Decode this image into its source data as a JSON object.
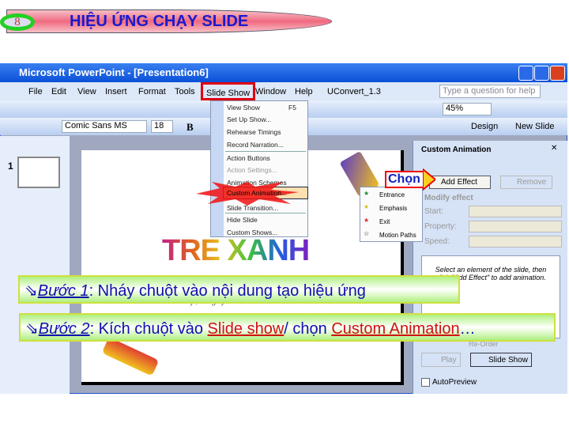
{
  "slide": {
    "number": "8",
    "title": "HIỆU ỨNG CHẠY SLIDE"
  },
  "window": {
    "title": "Microsoft PowerPoint - [Presentation6]"
  },
  "menubar": [
    "File",
    "Edit",
    "View",
    "Insert",
    "Format",
    "Tools",
    "Slide Show",
    "Window",
    "Help",
    "UConvert_1.3"
  ],
  "help_placeholder": "Type a question for help",
  "toolbar": {
    "zoom": "45%",
    "font": "Comic Sans MS",
    "size": "18",
    "bold": "B",
    "design": "Design",
    "new_slide": "New Slide"
  },
  "thumbnail_number": "1",
  "slideshow_menu": [
    {
      "label": "View Show",
      "shortcut": "F5"
    },
    {
      "label": "Set Up Show..."
    },
    {
      "label": "Rehearse Timings"
    },
    {
      "label": "Record Narration..."
    },
    {
      "label": "Action Buttons"
    },
    {
      "label": "Action Settings..."
    },
    {
      "label": "Animation Schemes"
    },
    {
      "label": "Custom Animation..."
    },
    {
      "label": "Slide Transition..."
    },
    {
      "label": "Hide Slide"
    },
    {
      "label": "Custom Shows..."
    }
  ],
  "add_effect_submenu": [
    "Entrance",
    "Emphasis",
    "Exit",
    "Motion Paths"
  ],
  "task_pane": {
    "title": "Custom Animation",
    "add_effect": "Add Effect",
    "remove": "Remove",
    "modify": "Modify effect",
    "fields": [
      "Start:",
      "Property:",
      "Speed:"
    ],
    "hint": "Select an element of the slide, then click \"Add Effect\" to add animation.",
    "reorder": "Re-Order",
    "play": "Play",
    "slide_show": "Slide Show",
    "autopreview": "AutoPreview"
  },
  "slide_content": {
    "logo": "TRE XANH",
    "subtitle": "Chuyện ngày xưa đã có bờ tre xanh"
  },
  "callout": "Chọn",
  "steps": [
    {
      "label": "Bước 1",
      "text": ":  Nháy chuột vào nội dung tạo hiệu ứng"
    },
    {
      "label": "Bước 2",
      "text": ": Kích chuột vào ",
      "link1": "Slide show",
      "mid": "/ chọn ",
      "link2": "Custom Animation",
      "end": "…"
    }
  ],
  "colors": {
    "accent_blue": "#1010b0",
    "highlight_red": "#d01010",
    "step_green": "#b0f080"
  }
}
